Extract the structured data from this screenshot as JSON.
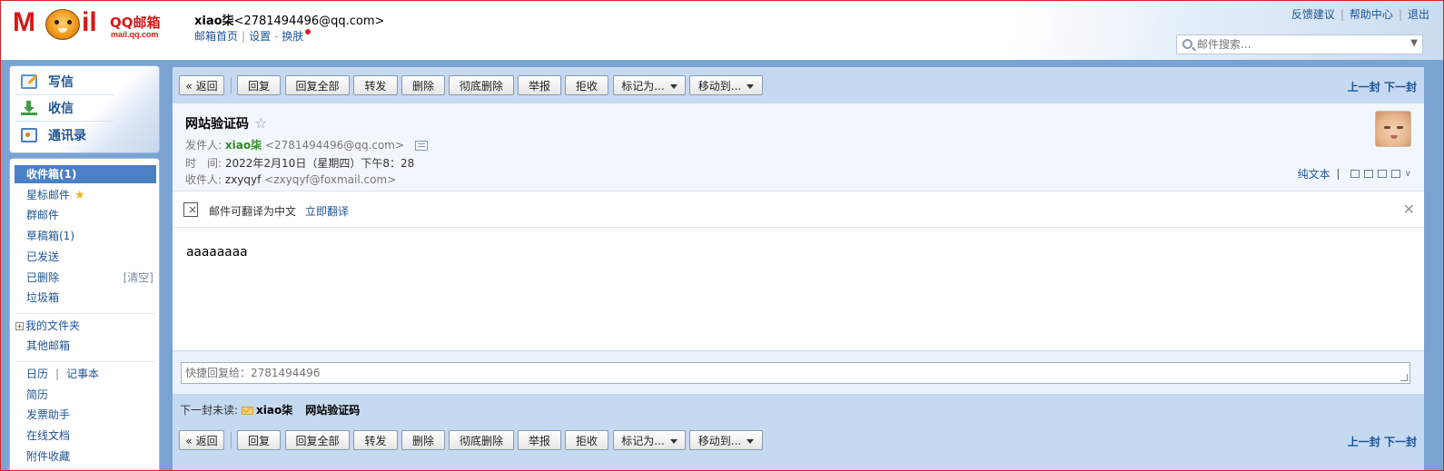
{
  "header": {
    "logo_brand": "QQ邮箱",
    "logo_domain": "mail.qq.com",
    "user_name": "xiao柒",
    "user_email": "<2781494496@qq.com>",
    "links": [
      "邮箱首页",
      "设置",
      "换肤"
    ],
    "top_links": [
      "反馈建议",
      "帮助中心",
      "退出"
    ],
    "search_placeholder": "邮件搜索..."
  },
  "sidebar": {
    "quick": [
      {
        "label": "写信",
        "icon": "compose-icon"
      },
      {
        "label": "收信",
        "icon": "inbox-download-icon"
      },
      {
        "label": "通讯录",
        "icon": "contacts-icon"
      }
    ],
    "folders": {
      "inbox": "收件箱(1)",
      "starred": "星标邮件",
      "group": "群邮件",
      "drafts": "草稿箱(1)",
      "sent": "已发送",
      "deleted": "已删除",
      "clear": "[清空]",
      "spam": "垃圾箱",
      "my_folders": "我的文件夹",
      "other_mail": "其他邮箱",
      "calendar": "日历",
      "notes": "记事本",
      "resume": "简历",
      "invoice": "发票助手",
      "docs": "在线文档",
      "attachments": "附件收藏"
    }
  },
  "toolbar": {
    "back": "« 返回",
    "reply": "回复",
    "reply_all": "回复全部",
    "forward": "转发",
    "delete": "删除",
    "delete_permanent": "彻底删除",
    "report": "举报",
    "reject": "拒收",
    "mark_as": "标记为...",
    "move_to": "移动到...",
    "prev": "上一封",
    "next": "下一封"
  },
  "mail": {
    "subject": "网站验证码",
    "from_label": "发件人:",
    "from_name": "xiao柒",
    "from_email": "<2781494496@qq.com>",
    "time_label": "时　间:",
    "time_value": "2022年2月10日（星期四）下午8：28",
    "to_label": "收件人:",
    "to_name": "zxyqyf",
    "to_email": "<zxyqyf@foxmail.com>",
    "plain_text": "纯文本",
    "body": "aaaaaaaa"
  },
  "translate": {
    "text": "邮件可翻译为中文",
    "link": "立即翻译"
  },
  "quick_reply": {
    "placeholder": "快捷回复给：2781494496"
  },
  "next_unread": {
    "label": "下一封未读:",
    "sender": "xiao柒",
    "subject": "网站验证码"
  },
  "colors": {
    "accent": "#1e5494",
    "toolbar_bg": "#c5d9f1",
    "active_folder": "#4b80c5",
    "sender_green": "#2e8b1f"
  }
}
